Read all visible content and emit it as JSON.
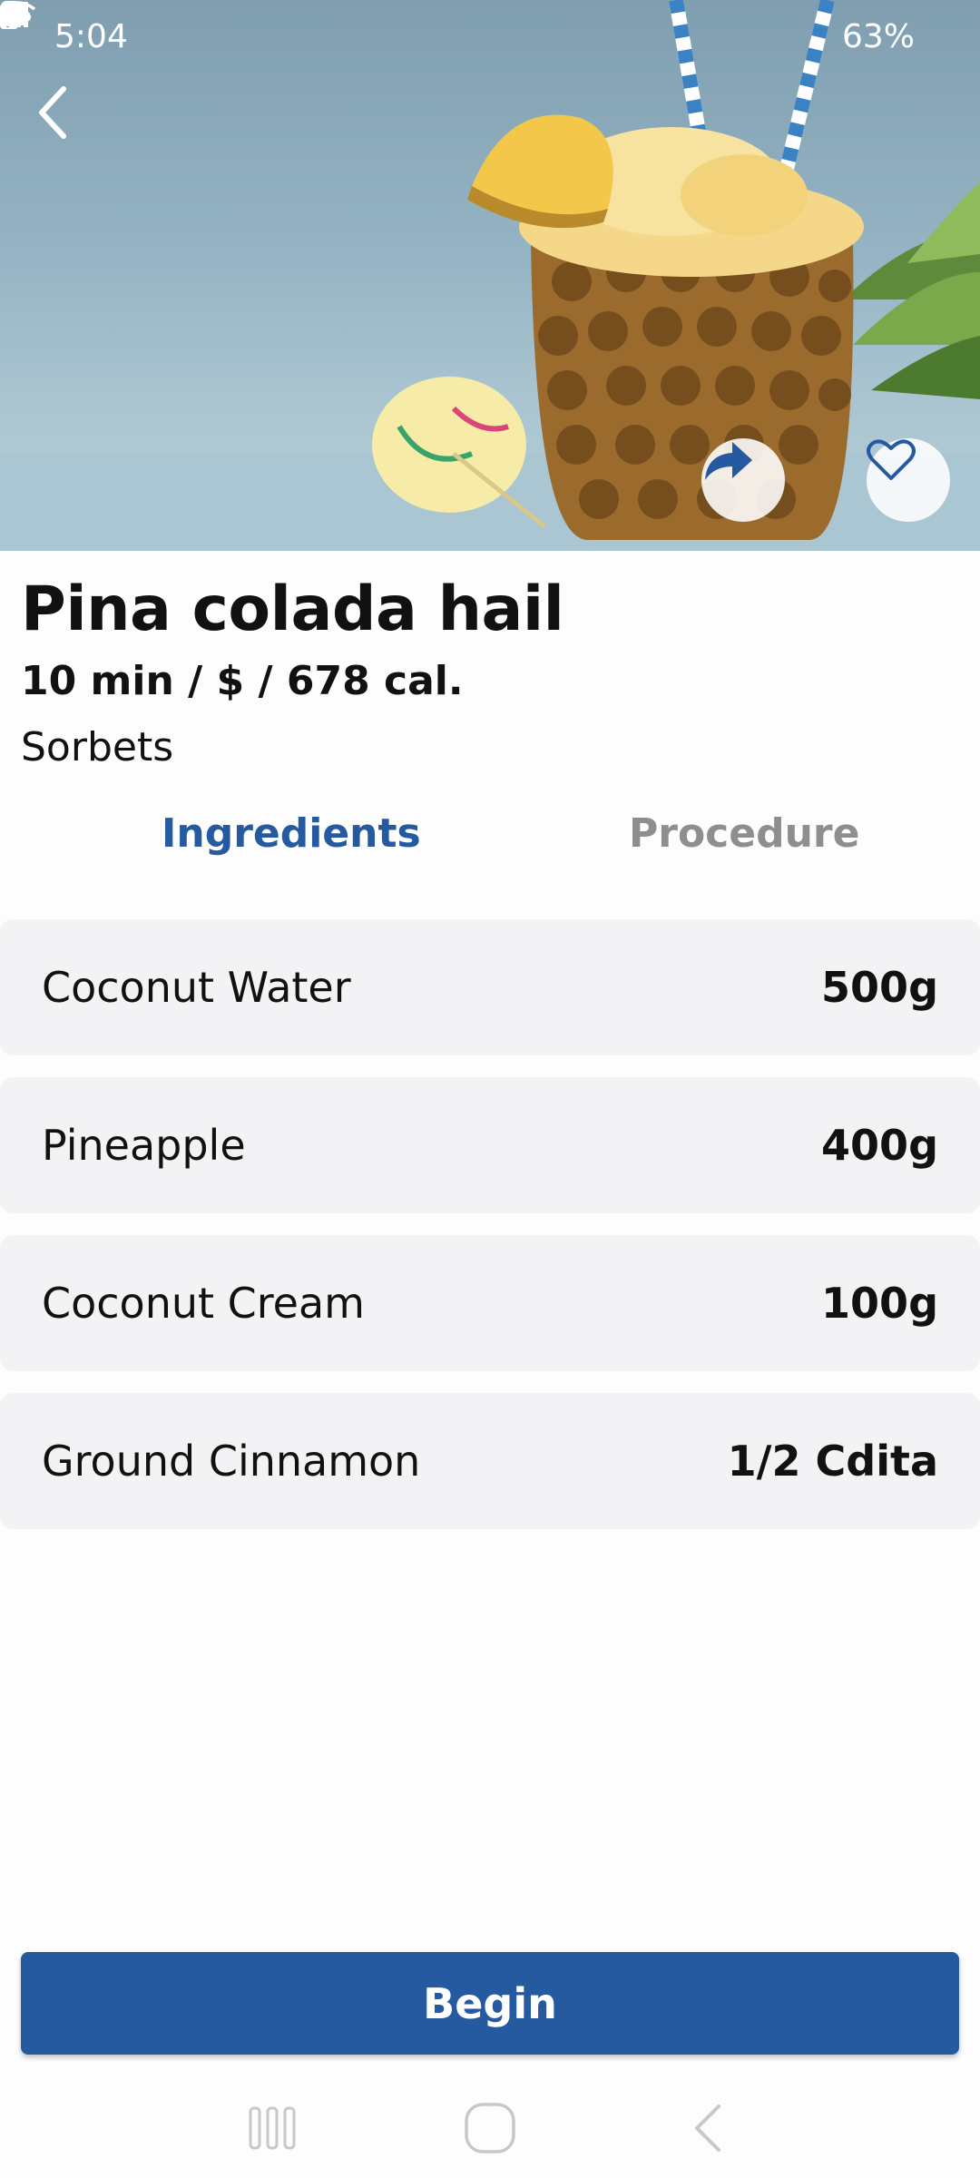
{
  "status_bar": {
    "time": "5:04",
    "battery": "63%",
    "icons": [
      "image-icon",
      "gear-icon",
      "cloud-icon",
      "dot-icon",
      "wifi-icon",
      "signal-icon",
      "battery-icon"
    ]
  },
  "hero": {
    "subject": "pineapple-sorbet-image",
    "actions": [
      "back-arrow-icon",
      "share-arrow-icon",
      "heart-icon"
    ]
  },
  "recipe": {
    "title": "Pina colada hail",
    "meta": "10 min / $ / 678 cal.",
    "category": "Sorbets"
  },
  "tabs": [
    {
      "label": "Ingredients",
      "active": true
    },
    {
      "label": "Procedure",
      "active": false
    }
  ],
  "ingredients": [
    {
      "name": "Coconut Water",
      "quantity": "500g"
    },
    {
      "name": "Pineapple",
      "quantity": "400g"
    },
    {
      "name": "Coconut Cream",
      "quantity": "100g"
    },
    {
      "name": "Ground Cinnamon",
      "quantity": "1/2 Cdita"
    }
  ],
  "actions": {
    "begin_label": "Begin"
  },
  "nav": {
    "icons": [
      "recents-icon",
      "home-icon",
      "back-icon"
    ]
  },
  "colors": {
    "accent": "#265aa0",
    "inactive_tab": "#8e8e8e",
    "row_background": "#f3f3f5"
  }
}
